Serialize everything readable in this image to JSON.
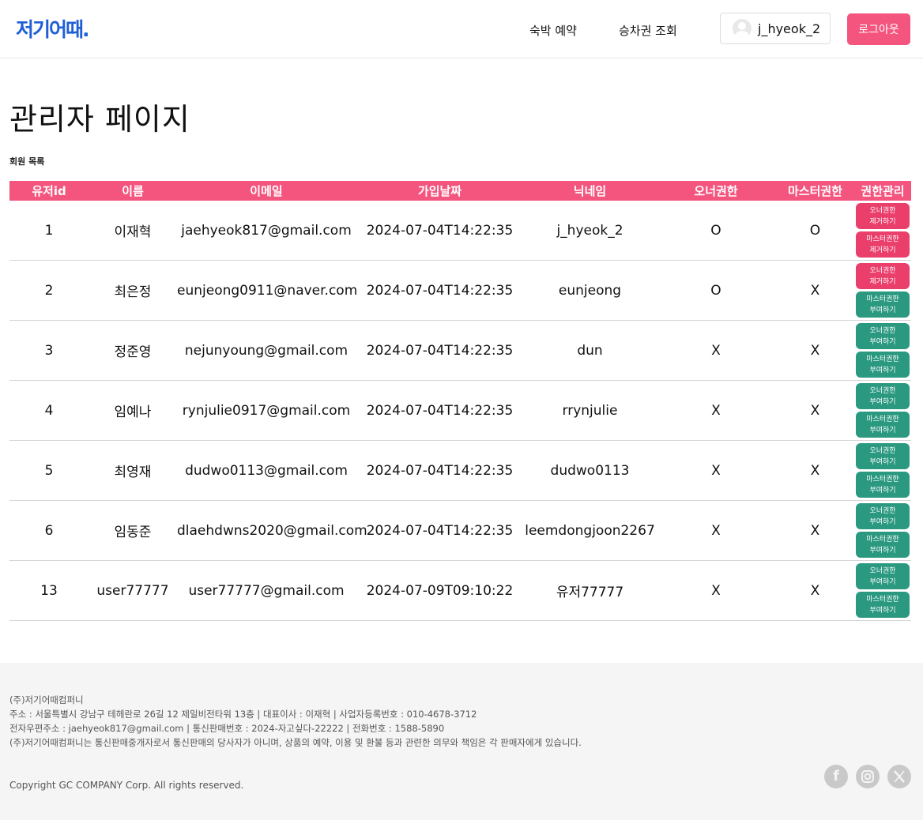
{
  "header": {
    "logo": "저기어때.",
    "nav": [
      "숙박 예약",
      "승차권 조회"
    ],
    "username": "j_hyeok_2",
    "logout_label": "로그아웃"
  },
  "main": {
    "title": "관리자 페이지",
    "section_label": "회원 목록",
    "columns": [
      "유저id",
      "이름",
      "이메일",
      "가입날짜",
      "닉네임",
      "오너권한",
      "마스터권한",
      "권한관리"
    ],
    "rows": [
      {
        "id": "1",
        "name": "이재혁",
        "email": "jaehyeok817@gmail.com",
        "joined": "2024-07-04T14:22:35",
        "nickname": "j_hyeok_2",
        "owner": "O",
        "master": "O",
        "actions": [
          {
            "label1": "오너권한",
            "label2": "제거하기",
            "kind": "revoke"
          },
          {
            "label1": "마스터권한",
            "label2": "제거하기",
            "kind": "revoke"
          }
        ]
      },
      {
        "id": "2",
        "name": "최은정",
        "email": "eunjeong0911@naver.com",
        "joined": "2024-07-04T14:22:35",
        "nickname": "eunjeong",
        "owner": "O",
        "master": "X",
        "actions": [
          {
            "label1": "오너권한",
            "label2": "제거하기",
            "kind": "revoke"
          },
          {
            "label1": "마스터권한",
            "label2": "부여하기",
            "kind": "grant"
          }
        ]
      },
      {
        "id": "3",
        "name": "정준영",
        "email": "nejunyoung@gmail.com",
        "joined": "2024-07-04T14:22:35",
        "nickname": "dun",
        "owner": "X",
        "master": "X",
        "actions": [
          {
            "label1": "오너권한",
            "label2": "부여하기",
            "kind": "grant"
          },
          {
            "label1": "마스터권한",
            "label2": "부여하기",
            "kind": "grant"
          }
        ]
      },
      {
        "id": "4",
        "name": "임예나",
        "email": "rynjulie0917@gmail.com",
        "joined": "2024-07-04T14:22:35",
        "nickname": "rrynjulie",
        "owner": "X",
        "master": "X",
        "actions": [
          {
            "label1": "오너권한",
            "label2": "부여하기",
            "kind": "grant"
          },
          {
            "label1": "마스터권한",
            "label2": "부여하기",
            "kind": "grant"
          }
        ]
      },
      {
        "id": "5",
        "name": "최영재",
        "email": "dudwo0113@gmail.com",
        "joined": "2024-07-04T14:22:35",
        "nickname": "dudwo0113",
        "owner": "X",
        "master": "X",
        "actions": [
          {
            "label1": "오너권한",
            "label2": "부여하기",
            "kind": "grant"
          },
          {
            "label1": "마스터권한",
            "label2": "부여하기",
            "kind": "grant"
          }
        ]
      },
      {
        "id": "6",
        "name": "임동준",
        "email": "dlaehdwns2020@gmail.com",
        "joined": "2024-07-04T14:22:35",
        "nickname": "leemdongjoon2267",
        "owner": "X",
        "master": "X",
        "actions": [
          {
            "label1": "오너권한",
            "label2": "부여하기",
            "kind": "grant"
          },
          {
            "label1": "마스터권한",
            "label2": "부여하기",
            "kind": "grant"
          }
        ]
      },
      {
        "id": "13",
        "name": "user77777",
        "email": "user77777@gmail.com",
        "joined": "2024-07-09T09:10:22",
        "nickname": "유저77777",
        "owner": "X",
        "master": "X",
        "actions": [
          {
            "label1": "오너권한",
            "label2": "부여하기",
            "kind": "grant"
          },
          {
            "label1": "마스터권한",
            "label2": "부여하기",
            "kind": "grant"
          }
        ]
      }
    ]
  },
  "footer": {
    "lines": [
      "(주)저기어때컴퍼니",
      "주소 : 서울특별시 강남구 테헤란로 26길 12 제일비전타워 13층 | 대표이사 : 이재혁 | 사업자등록번호 : 010-4678-3712",
      "전자우편주소 : jaehyeok817@gmail.com | 통신판매번호 : 2024-자고싶다-22222 | 전화번호 : 1588-5890",
      "(주)저기어때컴퍼니는 통신판매중개자로서 통신판매의 당사자가 아니며, 상품의 예약, 이용 및 환불 등과 관련한 의무와 책임은 각 판매자에게 있습니다."
    ],
    "copyright": "Copyright GC COMPANY Corp. All rights reserved.",
    "social_icons": [
      "facebook-icon",
      "instagram-icon",
      "x-icon"
    ]
  },
  "colors": {
    "accent": "#f4557f",
    "revoke": "#ea3e6b",
    "grant": "#2b9880",
    "logo": "#1f5fd6"
  }
}
